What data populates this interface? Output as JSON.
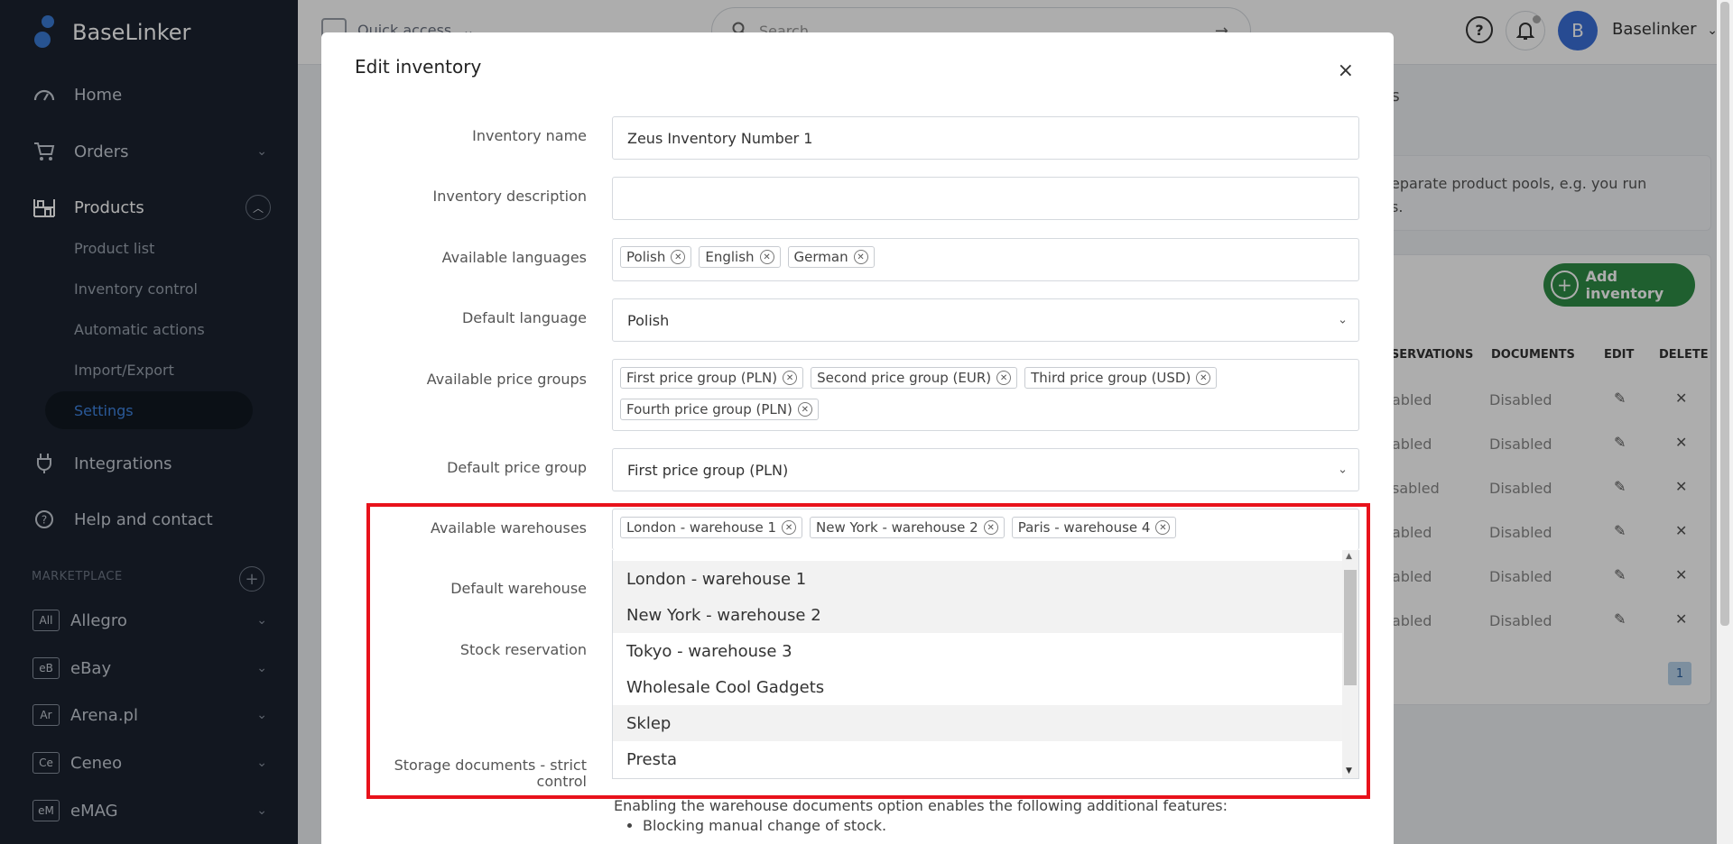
{
  "app": {
    "name": "BaseLinker"
  },
  "sidebar": {
    "items": [
      {
        "label": "Home"
      },
      {
        "label": "Orders"
      },
      {
        "label": "Products"
      },
      {
        "label": "Integrations"
      },
      {
        "label": "Help and contact"
      }
    ],
    "products_sub": [
      {
        "label": "Product list"
      },
      {
        "label": "Inventory control"
      },
      {
        "label": "Automatic actions"
      },
      {
        "label": "Import/Export"
      },
      {
        "label": "Settings"
      }
    ],
    "marketplace_label": "MARKETPLACE",
    "marketplaces": [
      {
        "badge": "All",
        "label": "Allegro"
      },
      {
        "badge": "eB",
        "label": "eBay"
      },
      {
        "badge": "Ar",
        "label": "Arena.pl"
      },
      {
        "badge": "Ce",
        "label": "Ceneo"
      },
      {
        "badge": "eM",
        "label": "eMAG"
      }
    ]
  },
  "topbar": {
    "quick_access": "Quick access",
    "search_placeholder": "Search",
    "avatar_letter": "B",
    "user_name": "Baselinker"
  },
  "background": {
    "tab_fragment": "gs",
    "info_line1": "eparate product pools, e.g. you run",
    "info_line2": "s.",
    "add_inventory": "Add inventory",
    "columns": [
      "ESERVATIONS",
      "DOCUMENTS",
      "EDIT",
      "DELETE"
    ],
    "rows": [
      {
        "reservations": "abled",
        "documents": "Disabled"
      },
      {
        "reservations": "abled",
        "documents": "Disabled"
      },
      {
        "reservations": "sabled",
        "documents": "Disabled"
      },
      {
        "reservations": "abled",
        "documents": "Disabled"
      },
      {
        "reservations": "abled",
        "documents": "Disabled"
      },
      {
        "reservations": "abled",
        "documents": "Disabled"
      }
    ],
    "page": "1"
  },
  "modal": {
    "title": "Edit inventory",
    "close": "×",
    "fields": {
      "inventory_name": {
        "label": "Inventory name",
        "value": "Zeus Inventory Number 1"
      },
      "inventory_description": {
        "label": "Inventory description",
        "value": ""
      },
      "available_languages": {
        "label": "Available languages",
        "tags": [
          "Polish",
          "English",
          "German"
        ]
      },
      "default_language": {
        "label": "Default language",
        "value": "Polish"
      },
      "available_price_groups": {
        "label": "Available price groups",
        "tags": [
          "First price group (PLN)",
          "Second price group (EUR)",
          "Third price group (USD)",
          "Fourth price group (PLN)"
        ]
      },
      "default_price_group": {
        "label": "Default price group",
        "value": "First price group (PLN)"
      },
      "available_warehouses": {
        "label": "Available warehouses",
        "tags": [
          "London - warehouse 1",
          "New York - warehouse 2",
          "Paris - warehouse 4"
        ]
      },
      "default_warehouse": {
        "label": "Default warehouse"
      },
      "stock_reservation": {
        "label": "Stock reservation"
      },
      "storage_documents": {
        "label_line1": "Storage documents - strict",
        "label_line2": "control"
      }
    },
    "warehouse_options": [
      "London - warehouse 1",
      "New York - warehouse 2",
      "Tokyo - warehouse 3",
      "Wholesale Cool Gadgets",
      "Sklep",
      "Presta"
    ],
    "documents_info": "Enabling the warehouse documents option enables the following additional features:",
    "documents_bullets": [
      "Blocking manual change of stock."
    ]
  },
  "colors": {
    "sidebar_bg": "#1b2330",
    "accent": "#3f84e0",
    "add_button": "#2f8c46",
    "highlight_frame": "#e8121b"
  }
}
